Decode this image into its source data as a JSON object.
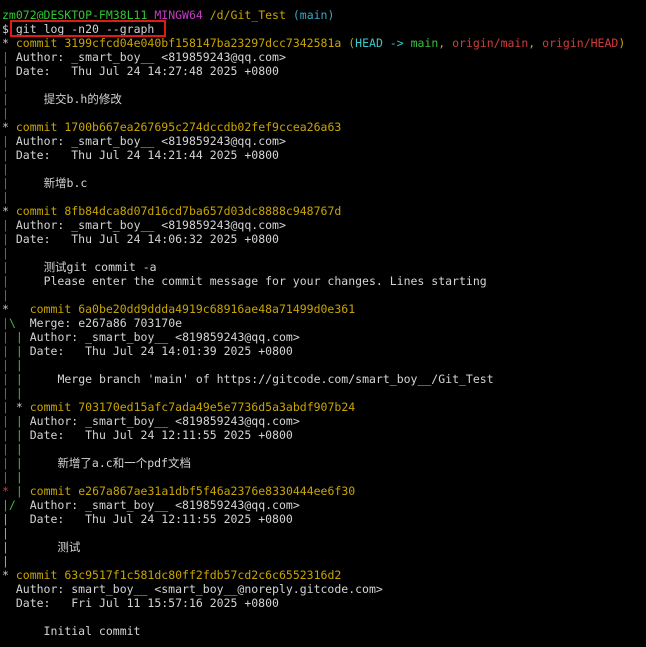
{
  "prompt": {
    "user_host": "zm072@DESKTOP-FM38L11",
    "env": "MINGW64",
    "path": "/d/Git_Test",
    "branch": "(main)",
    "symbol": "$",
    "command": "git log -n20 --graph"
  },
  "colors": {
    "background": "#000000",
    "commit_hash": "#c8a500",
    "highlight_box": "#e01919"
  },
  "log": [
    {
      "commit_label": "commit",
      "hash": "3199cfcd04e040bf158147ba23297dcc7342581a",
      "refs": {
        "open": "(",
        "head": "HEAD -> ",
        "main": "main",
        "sep1": ", ",
        "origin_main": "origin/main",
        "sep2": ", ",
        "origin_head": "origin/HEAD",
        "close": ")"
      },
      "author": "Author: _smart_boy__ <819859243@qq.com>",
      "date": "Date:   Thu Jul 24 14:27:48 2025 +0800",
      "message": [
        "提交b.h的修改"
      ]
    },
    {
      "commit_label": "commit",
      "hash": "1700b667ea267695c274dccdb02fef9ccea26a63",
      "author": "Author: _smart_boy__ <819859243@qq.com>",
      "date": "Date:   Thu Jul 24 14:21:44 2025 +0800",
      "message": [
        "新增b.c"
      ]
    },
    {
      "commit_label": "commit",
      "hash": "8fb84dca8d07d16cd7ba657d03dc8888c948767d",
      "author": "Author: _smart_boy__ <819859243@qq.com>",
      "date": "Date:   Thu Jul 24 14:06:32 2025 +0800",
      "message": [
        "测试git commit -a",
        "Please enter the commit message for your changes. Lines starting"
      ]
    },
    {
      "commit_label": "commit",
      "hash": "6a0be20dd9ddda4919c68916ae48a71499d0e361",
      "merge": "Merge: e267a86 703170e",
      "author": "Author: _smart_boy__ <819859243@qq.com>",
      "date": "Date:   Thu Jul 24 14:01:39 2025 +0800",
      "message": [
        "Merge branch 'main' of https://gitcode.com/smart_boy__/Git_Test"
      ]
    },
    {
      "commit_label": "commit",
      "hash": "703170ed15afc7ada49e5e7736d5a3abdf907b24",
      "author": "Author: _smart_boy__ <819859243@qq.com>",
      "date": "Date:   Thu Jul 24 12:11:55 2025 +0800",
      "message": [
        "新增了a.c和一个pdf文档"
      ]
    },
    {
      "commit_label": "commit",
      "hash": "e267a867ae31a1dbf5f46a2376e8330444ee6f30",
      "author": "Author: _smart_boy__ <819859243@qq.com>",
      "date": "Date:   Thu Jul 24 12:11:55 2025 +0800",
      "message": [
        "测试"
      ]
    },
    {
      "commit_label": "commit",
      "hash": "63c9517f1c581dc80ff2fdb57cd2c6c6552316d2",
      "author": "Author: smart_boy__ <smart_boy__@noreply.gitcode.com>",
      "date": "Date:   Fri Jul 11 15:57:16 2025 +0800",
      "message": [
        "Initial commit"
      ]
    }
  ]
}
